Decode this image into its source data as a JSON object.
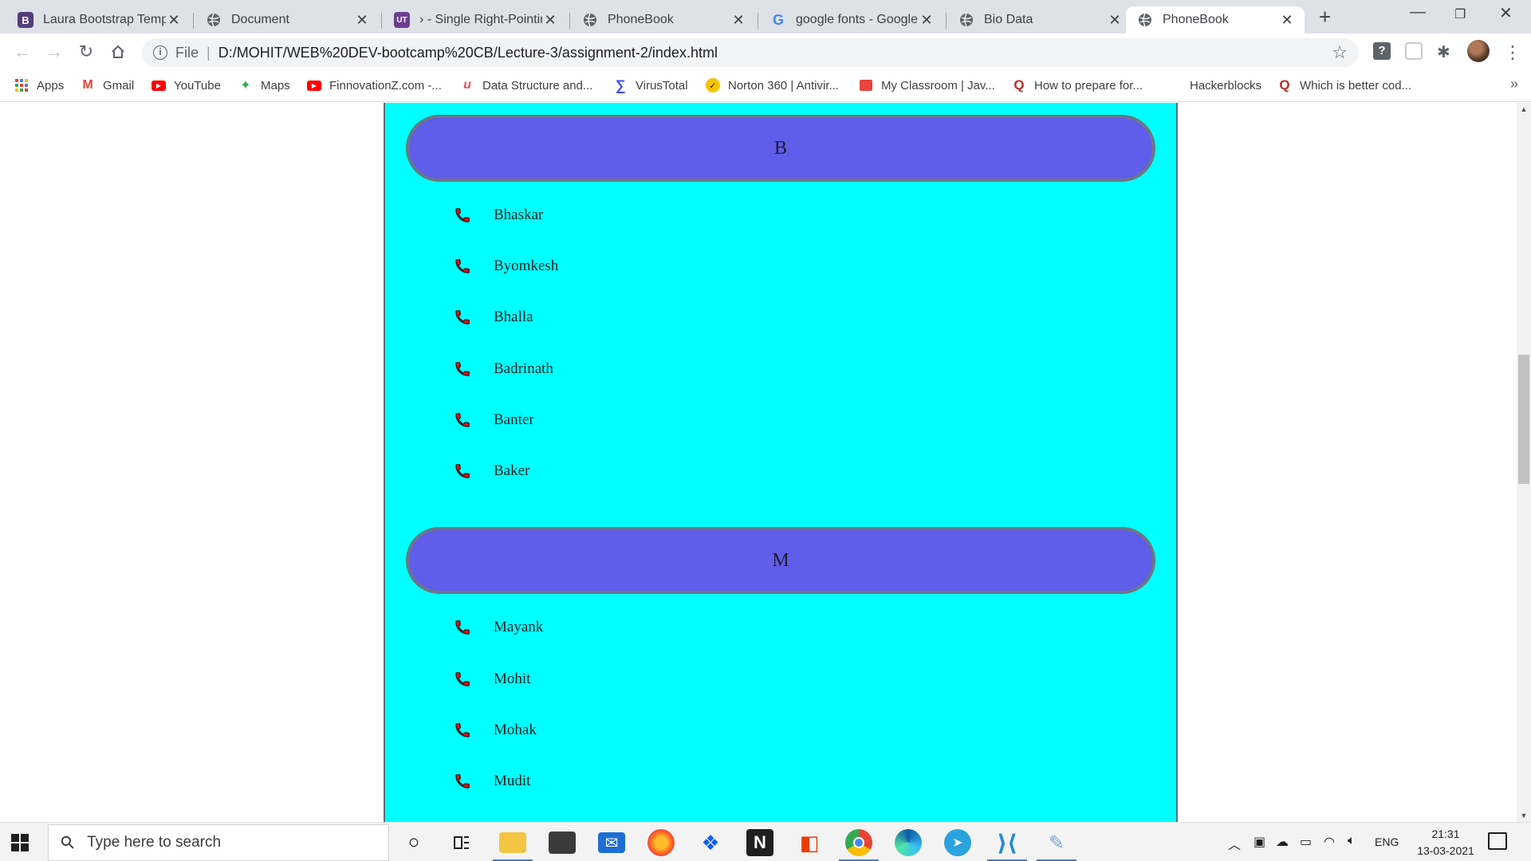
{
  "browser": {
    "tabs": [
      {
        "title": "Laura Bootstrap Templa",
        "favicon": "B",
        "favicon_color": "#563d7c"
      },
      {
        "title": "Document",
        "favicon": "globe",
        "favicon_color": "#5f6368"
      },
      {
        "title": "› - Single Right-Pointin",
        "favicon": "UT",
        "favicon_color": "#6c3e8f"
      },
      {
        "title": "PhoneBook",
        "favicon": "globe",
        "favicon_color": "#5f6368"
      },
      {
        "title": "google fonts - Google",
        "favicon": "G",
        "favicon_color": "#4285f4"
      },
      {
        "title": "Bio Data",
        "favicon": "globe",
        "favicon_color": "#5f6368"
      },
      {
        "title": "PhoneBook",
        "favicon": "globe",
        "favicon_color": "#5f6368",
        "active": true
      }
    ],
    "new_tab_icon": "+",
    "address": {
      "scheme": "File",
      "url": "D:/MOHIT/WEB%20DEV-bootcamp%20CB/Lecture-3/assignment-2/index.html"
    },
    "bookmarks": [
      {
        "label": "Apps",
        "icon": "apps-grid-icon"
      },
      {
        "label": "Gmail",
        "icon": "gmail-icon",
        "color": "#ea4335"
      },
      {
        "label": "YouTube",
        "icon": "youtube-icon",
        "color": "#ff0000"
      },
      {
        "label": "Maps",
        "icon": "maps-icon",
        "color": "#34a853"
      },
      {
        "label": "FinnovationZ.com -...",
        "icon": "youtube-icon",
        "color": "#ff0000"
      },
      {
        "label": "Data Structure and...",
        "icon": "udemy-icon",
        "color": "#ec5252"
      },
      {
        "label": "VirusTotal",
        "icon": "virustotal-icon",
        "color": "#394eff"
      },
      {
        "label": "Norton 360 | Antivir...",
        "icon": "norton-icon",
        "color": "#f5c400"
      },
      {
        "label": "My Classroom | Jav...",
        "icon": "classroom-icon",
        "color": "#e8453c"
      },
      {
        "label": "How to prepare for...",
        "icon": "quora-icon",
        "color": "#b92b27"
      },
      {
        "label": "Hackerblocks",
        "icon": "none"
      },
      {
        "label": "Which is better cod...",
        "icon": "quora-icon",
        "color": "#b92b27"
      }
    ],
    "more_bookmarks": "»"
  },
  "phonebook": {
    "accent_color": "#00ffff",
    "header_color": "#5f5dea",
    "icon_color": "#e01010",
    "sections": [
      {
        "letter": "B",
        "contacts": [
          "Bhaskar",
          "Byomkesh",
          "Bhalla",
          "Badrinath",
          "Banter",
          "Baker"
        ]
      },
      {
        "letter": "M",
        "contacts": [
          "Mayank",
          "Mohit",
          "Mohak",
          "Mudit"
        ]
      }
    ]
  },
  "taskbar": {
    "search_placeholder": "Type here to search",
    "language": "ENG",
    "time": "21:31",
    "date": "13-03-2021"
  }
}
